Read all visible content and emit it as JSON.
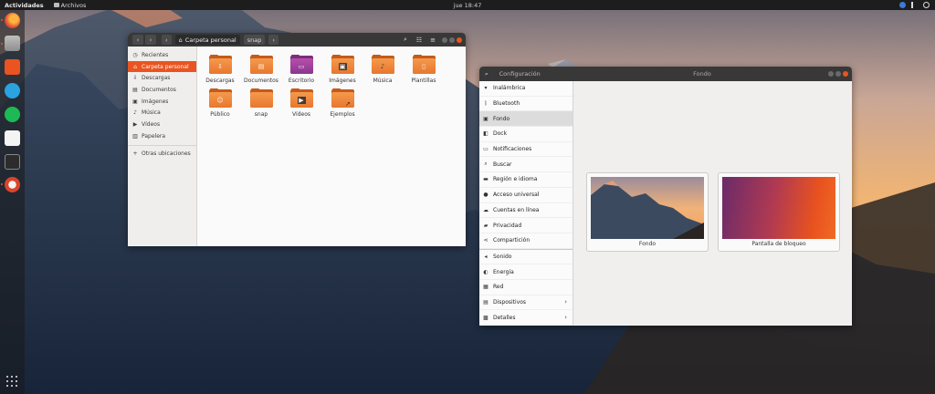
{
  "topbar": {
    "activities": "Actividades",
    "app_menu": "Archivos",
    "clock": "jue 18:47"
  },
  "dock": {
    "items": [
      {
        "name": "firefox"
      },
      {
        "name": "files"
      },
      {
        "name": "software"
      },
      {
        "name": "telegram"
      },
      {
        "name": "spotify"
      },
      {
        "name": "slack"
      },
      {
        "name": "terminal"
      },
      {
        "name": "settings"
      }
    ]
  },
  "files_window": {
    "breadcrumb": [
      "Carpeta personal",
      "snap"
    ],
    "sidebar": {
      "items": [
        {
          "label": "Recientes",
          "icon": "clock-icon"
        },
        {
          "label": "Carpeta personal",
          "icon": "home-icon",
          "selected": true
        },
        {
          "label": "Descargas",
          "icon": "download-icon"
        },
        {
          "label": "Documentos",
          "icon": "document-icon"
        },
        {
          "label": "Imágenes",
          "icon": "image-icon"
        },
        {
          "label": "Música",
          "icon": "music-icon"
        },
        {
          "label": "Vídeos",
          "icon": "video-icon"
        },
        {
          "label": "Papelera",
          "icon": "trash-icon"
        }
      ],
      "other": "Otras ubicaciones"
    },
    "folders": [
      {
        "label": "Descargas",
        "icon": "download-icon"
      },
      {
        "label": "Documentos",
        "icon": "document-icon"
      },
      {
        "label": "Escritorio",
        "icon": "desktop-icon"
      },
      {
        "label": "Imágenes",
        "icon": "image-icon"
      },
      {
        "label": "Música",
        "icon": "music-icon"
      },
      {
        "label": "Plantillas",
        "icon": "template-icon"
      },
      {
        "label": "Público",
        "icon": "person-icon"
      },
      {
        "label": "snap",
        "icon": "folder-icon"
      },
      {
        "label": "Vídeos",
        "icon": "video-icon"
      },
      {
        "label": "Ejemplos",
        "icon": "link-icon"
      }
    ]
  },
  "settings_window": {
    "search_label": "Configuración",
    "title": "Fondo",
    "items": [
      {
        "label": "Inalámbrica",
        "icon": "wifi-icon"
      },
      {
        "label": "Bluetooth",
        "icon": "bluetooth-icon"
      },
      {
        "label": "Fondo",
        "icon": "background-icon",
        "selected": true
      },
      {
        "label": "Dock",
        "icon": "dock-icon"
      },
      {
        "label": "Notificaciones",
        "icon": "bell-icon"
      },
      {
        "label": "Buscar",
        "icon": "search-icon"
      },
      {
        "label": "Región e idioma",
        "icon": "flag-icon"
      },
      {
        "label": "Acceso universal",
        "icon": "accessibility-icon"
      },
      {
        "label": "Cuentas en línea",
        "icon": "accounts-icon"
      },
      {
        "label": "Privacidad",
        "icon": "privacy-icon"
      },
      {
        "label": "Compartición",
        "icon": "share-icon"
      },
      {
        "label": "Sonido",
        "icon": "sound-icon"
      },
      {
        "label": "Energía",
        "icon": "power-icon"
      },
      {
        "label": "Red",
        "icon": "network-icon"
      },
      {
        "label": "Dispositivos",
        "icon": "devices-icon",
        "chevron": true
      },
      {
        "label": "Detalles",
        "icon": "info-icon",
        "chevron": true
      }
    ],
    "previews": [
      {
        "label": "Fondo"
      },
      {
        "label": "Pantalla de bloqueo"
      }
    ]
  },
  "colors": {
    "accent": "#e95420",
    "header": "#383838",
    "topbar": "#1d1d1d"
  }
}
